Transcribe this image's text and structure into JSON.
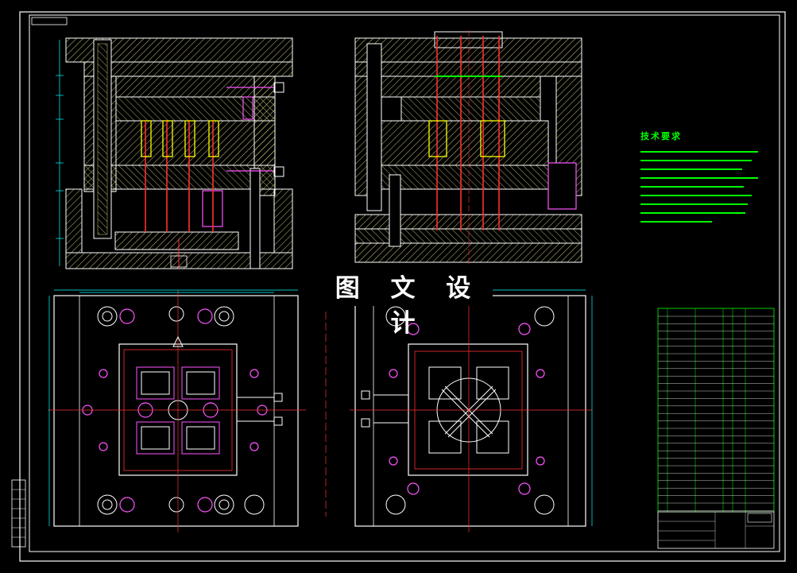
{
  "watermark": "图 文 设 计",
  "technical_requirements": {
    "title": "技术要求"
  },
  "colors": {
    "background": "#000000",
    "frame": "#ffffff",
    "hatch": "#c8c878",
    "pins": "#ff3030",
    "inserts": "#ffff00",
    "bolts": "#ff55ff",
    "dims": "#00ffff",
    "text": "#00ff00",
    "blue_line": "#3050ff"
  }
}
